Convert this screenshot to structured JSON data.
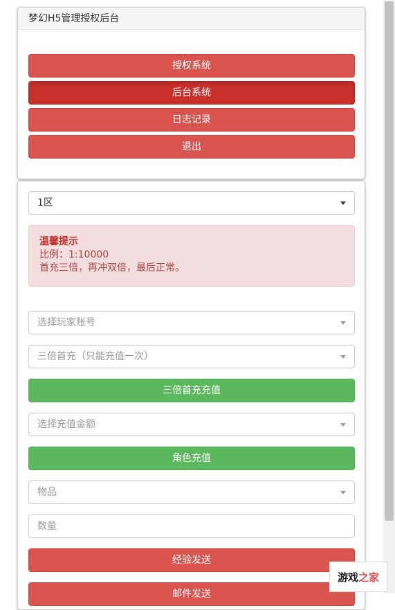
{
  "header": {
    "title": "梦幻H5管理授权后台"
  },
  "nav_buttons": [
    {
      "label": "授权系统",
      "active": false
    },
    {
      "label": "后台系统",
      "active": true
    },
    {
      "label": "日志记录",
      "active": false
    },
    {
      "label": "退出",
      "active": false
    }
  ],
  "server_select": {
    "value": "1区"
  },
  "notice": {
    "title": "温馨提示",
    "ratio": "比例：1:10000",
    "message": "首充三倍，再冲双倍，最后正常。"
  },
  "form": {
    "player_account_placeholder": "选择玩家账号",
    "triple_first_placeholder": "三倍首充（只能充值一次）",
    "triple_first_button": "三倍首充充值",
    "amount_placeholder": "选择充值金额",
    "role_recharge_button": "角色充值",
    "item_placeholder": "物品",
    "quantity_placeholder": "数量",
    "exp_send_button": "经验发送",
    "mail_send_button": "邮件发送"
  },
  "watermark": {
    "logo_text_a": "游戏",
    "logo_text_b": "之家"
  },
  "colors": {
    "danger": "#d9534f",
    "danger_active": "#c9302c",
    "success": "#5cb85c",
    "alert_bg": "#f2dede"
  }
}
